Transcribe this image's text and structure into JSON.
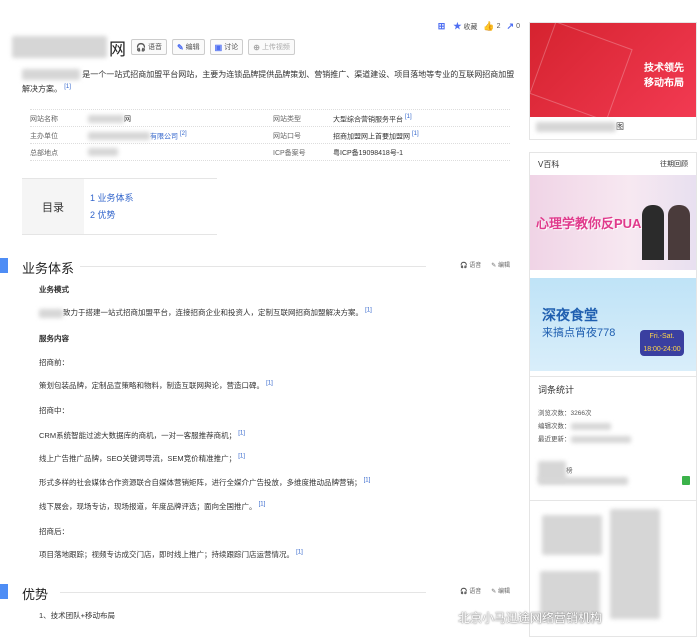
{
  "title": {
    "suffix": "网"
  },
  "title_buttons": [
    {
      "label": "语音",
      "icon": "headphones-icon"
    },
    {
      "label": "编辑",
      "icon": "pencil-icon"
    },
    {
      "label": "讨论",
      "icon": "chat-icon"
    },
    {
      "label": "上传视频",
      "icon": "plus-circle-icon"
    }
  ],
  "actions": {
    "favorite": "收藏",
    "likes": "2",
    "shares": "0"
  },
  "summary": {
    "text": "是一个一站式招商加盟平台网站，主要为连锁品牌提供品牌策划、营销推广、渠道建设、项目落地等专业的互联网招商加盟解决方案。",
    "ref": "[1]"
  },
  "info": [
    {
      "k1": "网站名称",
      "v1": "网",
      "r1": "",
      "k2": "网站类型",
      "v2": "大型综合营销服务平台",
      "r2": "[1]"
    },
    {
      "k1": "主办单位",
      "v1": "有限公司",
      "r1": "[2]",
      "k2": "网站口号",
      "v2": "招商加盟网上首要加盟网",
      "r2": "[1]"
    },
    {
      "k1": "总部地点",
      "v1": "",
      "r1": "",
      "k2": "ICP备案号",
      "v2": "粤ICP备19098418号-1",
      "r2": ""
    }
  ],
  "toc": {
    "label": "目录",
    "items": [
      "1  业务体系",
      "2  优势"
    ]
  },
  "sections": [
    {
      "title": "业务体系",
      "tools": [
        "语音",
        "编辑"
      ]
    },
    {
      "title": "优势",
      "tools": [
        "语音",
        "编辑"
      ]
    }
  ],
  "business": {
    "mode_head": "业务模式",
    "mode_text": "致力于搭建一站式招商加盟平台，连接招商企业和投资人，定制互联网招商加盟解决方案。",
    "content_head": "服务内容",
    "lines": [
      {
        "text": "招商前：",
        "ref": ""
      },
      {
        "text": "策划包装品牌，定制品宣策略和物料，制造互联网舆论，营造口碑。",
        "ref": "[1]"
      },
      {
        "text": "招商中：",
        "ref": ""
      },
      {
        "text": "CRM系统智能过滤大数据库的商机，一对一客服推荐商机；",
        "ref": "[1]"
      },
      {
        "text": "线上广告推广品牌，SEO关键词导流，SEM竞价精准推广；",
        "ref": "[1]"
      },
      {
        "text": "形式多样的社会媒体合作资源联合自媒体营销矩阵，进行全媒介广告投放，多维度推动品牌营销；",
        "ref": "[1]"
      },
      {
        "text": "线下展会，现场专访，现场报道，年度品牌评选；面向全国推广。",
        "ref": "[1]"
      },
      {
        "text": "招商后：",
        "ref": ""
      },
      {
        "text": "项目落地跟踪；视频专访成交门店，即时线上推广；持续跟踪门店运营情况。",
        "ref": "[1]"
      }
    ]
  },
  "advantage": {
    "first": "1、技术团队+移动布局"
  },
  "sidebar": {
    "ad_title1": "技术领先",
    "ad_title2": "移动布局",
    "ad_caption": "图",
    "v_head": "V百科",
    "v_link": "往期回顾",
    "banner1_text": "心理学教你反PUA",
    "banner2_t1": "深夜食堂",
    "banner2_t2": "来搞点宵夜778",
    "banner2_sign": "Fri.-Sat. 18:00-24:00",
    "stats_head": "词条统计",
    "stats_rows": [
      "浏览次数：3266次",
      "编辑次数：",
      "最近更新："
    ],
    "contributor_label": "榜"
  },
  "watermark": "北京小马迅途网络营销机构",
  "colors": {
    "accent": "#4e8df5",
    "link": "#3366cc",
    "ad_red": "#e0283a"
  }
}
